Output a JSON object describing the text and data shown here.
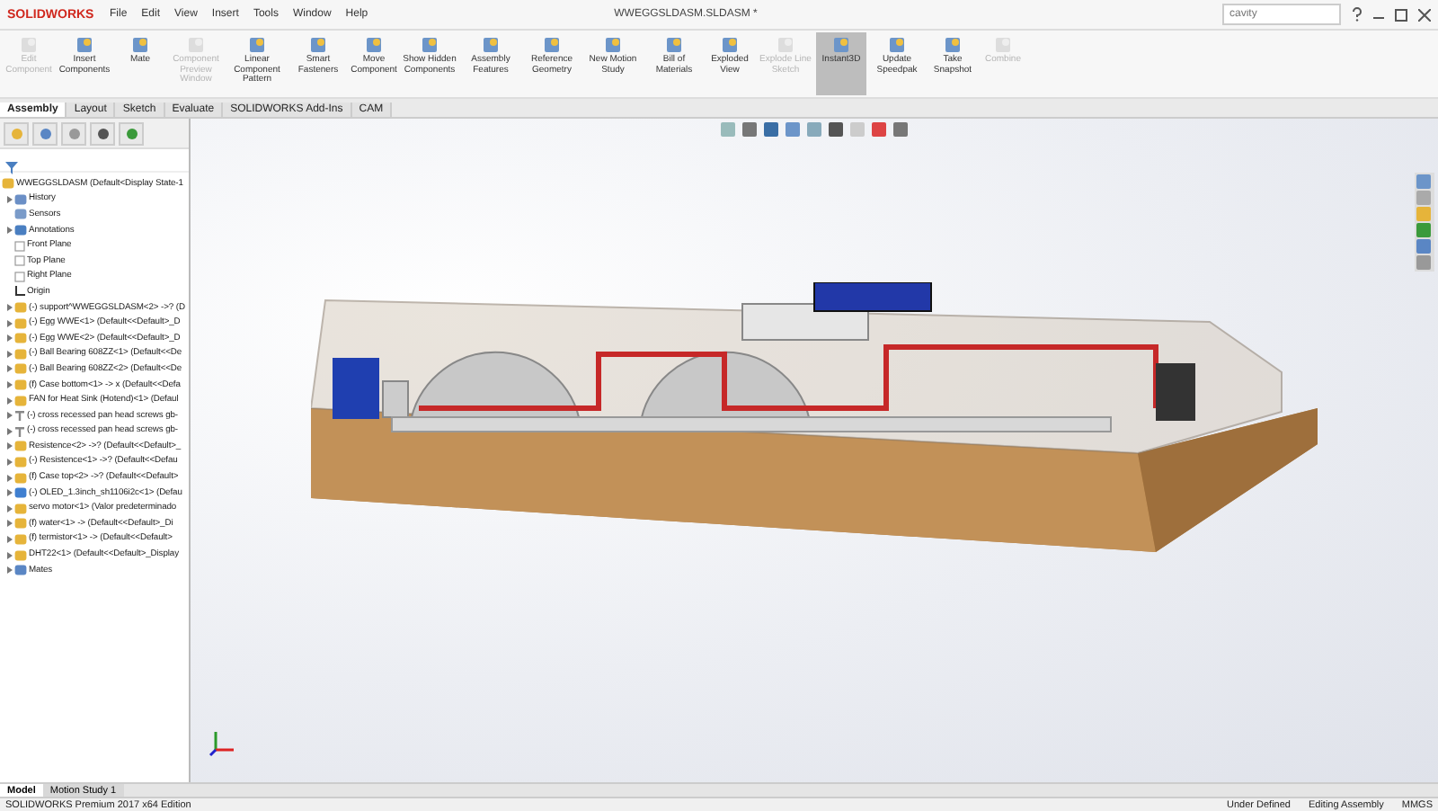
{
  "app": {
    "logo": "SOLIDWORKS",
    "menus": [
      "File",
      "Edit",
      "View",
      "Insert",
      "Tools",
      "Window",
      "Help"
    ],
    "document_title": "WWEGGSLDASM.SLDASM *",
    "search": {
      "placeholder": "cavity"
    }
  },
  "ribbon": [
    {
      "label": "Edit Component",
      "disabled": true,
      "selected": false
    },
    {
      "label": "Insert Components",
      "disabled": false,
      "selected": false
    },
    {
      "label": "Mate",
      "disabled": false,
      "selected": false
    },
    {
      "label": "Component Preview Window",
      "disabled": true,
      "selected": false
    },
    {
      "label": "Linear Component Pattern",
      "disabled": false,
      "selected": false
    },
    {
      "label": "Smart Fasteners",
      "disabled": false,
      "selected": false
    },
    {
      "label": "Move Component",
      "disabled": false,
      "selected": false
    },
    {
      "label": "Show Hidden Components",
      "disabled": false,
      "selected": false
    },
    {
      "label": "Assembly Features",
      "disabled": false,
      "selected": false
    },
    {
      "label": "Reference Geometry",
      "disabled": false,
      "selected": false
    },
    {
      "label": "New Motion Study",
      "disabled": false,
      "selected": false
    },
    {
      "label": "Bill of Materials",
      "disabled": false,
      "selected": false
    },
    {
      "label": "Exploded View",
      "disabled": false,
      "selected": false
    },
    {
      "label": "Explode Line Sketch",
      "disabled": true,
      "selected": false
    },
    {
      "label": "Instant3D",
      "disabled": false,
      "selected": true
    },
    {
      "label": "Update Speedpak",
      "disabled": false,
      "selected": false
    },
    {
      "label": "Take Snapshot",
      "disabled": false,
      "selected": false
    },
    {
      "label": "Combine",
      "disabled": true,
      "selected": false
    }
  ],
  "command_tabs": [
    {
      "label": "Assembly",
      "selected": true
    },
    {
      "label": "Layout",
      "selected": false
    },
    {
      "label": "Sketch",
      "selected": false
    },
    {
      "label": "Evaluate",
      "selected": false
    },
    {
      "label": "SOLIDWORKS Add-Ins",
      "selected": false
    },
    {
      "label": "CAM",
      "selected": false
    }
  ],
  "tree": {
    "root": "WWEGGSLDASM  (Default<Display State-1",
    "items": [
      {
        "kind": "folder",
        "label": "History"
      },
      {
        "kind": "sensor",
        "label": "Sensors"
      },
      {
        "kind": "annotation",
        "label": "Annotations"
      },
      {
        "kind": "plane",
        "label": "Front Plane"
      },
      {
        "kind": "plane",
        "label": "Top Plane"
      },
      {
        "kind": "plane",
        "label": "Right Plane"
      },
      {
        "kind": "origin",
        "label": "Origin"
      },
      {
        "kind": "part",
        "label": "(-) support^WWEGGSLDASM<2> ->? (D"
      },
      {
        "kind": "part",
        "label": "(-) Egg WWE<1> (Default<<Default>_D"
      },
      {
        "kind": "part",
        "label": "(-) Egg WWE<2> (Default<<Default>_D"
      },
      {
        "kind": "part",
        "label": "(-) Ball Bearing 608ZZ<1> (Default<<De"
      },
      {
        "kind": "part",
        "label": "(-) Ball Bearing 608ZZ<2> (Default<<De"
      },
      {
        "kind": "part",
        "label": "(f) Case bottom<1> -> x (Default<<Defa"
      },
      {
        "kind": "part",
        "label": "FAN for Heat Sink (Hotend)<1> (Defaul"
      },
      {
        "kind": "screw",
        "label": "(-) cross recessed pan head screws gb-"
      },
      {
        "kind": "screw",
        "label": "(-) cross recessed pan head screws gb-"
      },
      {
        "kind": "part",
        "label": "Resistence<2> ->? (Default<<Default>_"
      },
      {
        "kind": "part",
        "label": "(-) Resistence<1> ->? (Default<<Defau"
      },
      {
        "kind": "part",
        "label": "(f) Case top<2> ->? (Default<<Default>"
      },
      {
        "kind": "subassembly",
        "label": "(-) OLED_1.3inch_sh1106i2c<1> (Defau"
      },
      {
        "kind": "part",
        "label": "servo motor<1> (Valor predeterminado"
      },
      {
        "kind": "part",
        "label": "(f) water<1> -> (Default<<Default>_Di"
      },
      {
        "kind": "part",
        "label": "(f) termistor<1> -> (Default<<Default>"
      },
      {
        "kind": "part",
        "label": "DHT22<1> (Default<<Default>_Display"
      },
      {
        "kind": "mates",
        "label": "Mates"
      }
    ]
  },
  "bottom_tabs": [
    {
      "label": "Model",
      "selected": true
    },
    {
      "label": "Motion Study 1",
      "selected": false
    }
  ],
  "status_bar": {
    "edition": "SOLIDWORKS Premium 2017 x64 Edition",
    "state": "Under Defined",
    "mode": "Editing Assembly",
    "units": "MMGS"
  }
}
